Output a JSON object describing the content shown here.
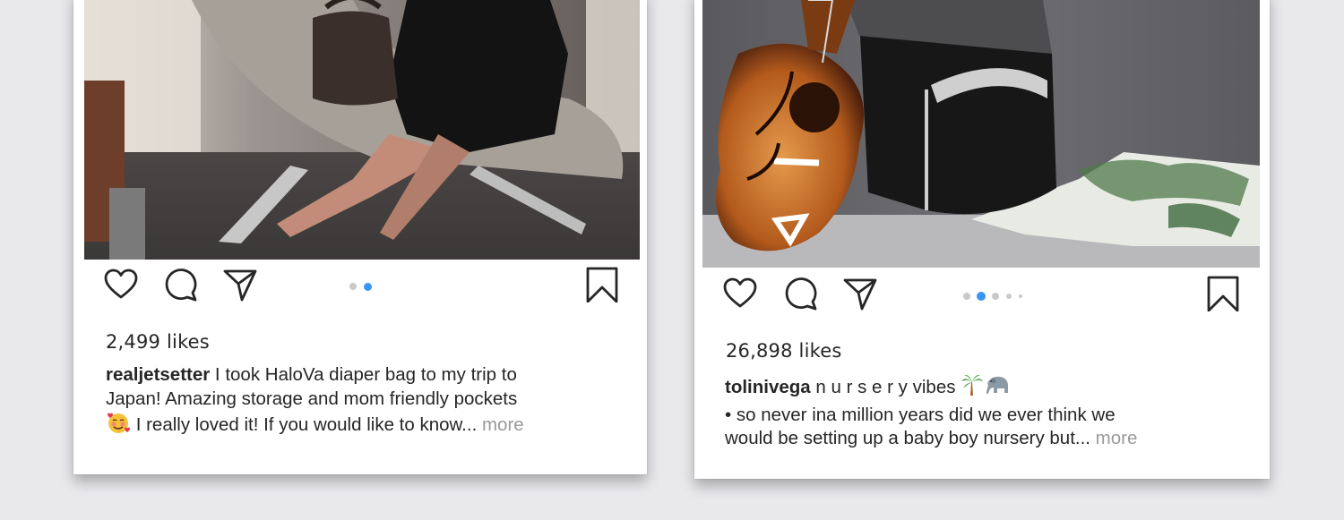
{
  "posts": [
    {
      "likes": "2,499 likes",
      "username": "realjetsetter",
      "caption_line1": " I took HaloVa diaper bag to my trip to",
      "caption_line2": "Japan! Amazing storage and mom friendly pockets",
      "caption_line3": " I really loved it! If you would like to know...",
      "more_label": " more",
      "carousel": {
        "count": 2,
        "active": 2
      },
      "emoji": [
        "smiling-face-with-hearts"
      ],
      "icons": [
        "heart-icon",
        "comment-icon",
        "share-icon",
        "bookmark-icon"
      ]
    },
    {
      "likes": "26,898 likes",
      "username": "tolinivega",
      "caption_line1": " n u r s e r y vibes",
      "caption_line2": "• so never ina million years did we ever think we",
      "caption_line3": "would be setting up a baby boy nursery but...",
      "more_label": " more",
      "carousel": {
        "count": 5,
        "active": 2
      },
      "emoji": [
        "palm-tree",
        "elephant"
      ],
      "icons": [
        "heart-icon",
        "comment-icon",
        "share-icon",
        "bookmark-icon"
      ]
    }
  ],
  "colors": {
    "text": "#262626",
    "muted": "#9a9a9a",
    "carousel_active": "#3897f0",
    "carousel_inactive": "#c9c9c9",
    "background": "#e9e9ec"
  }
}
